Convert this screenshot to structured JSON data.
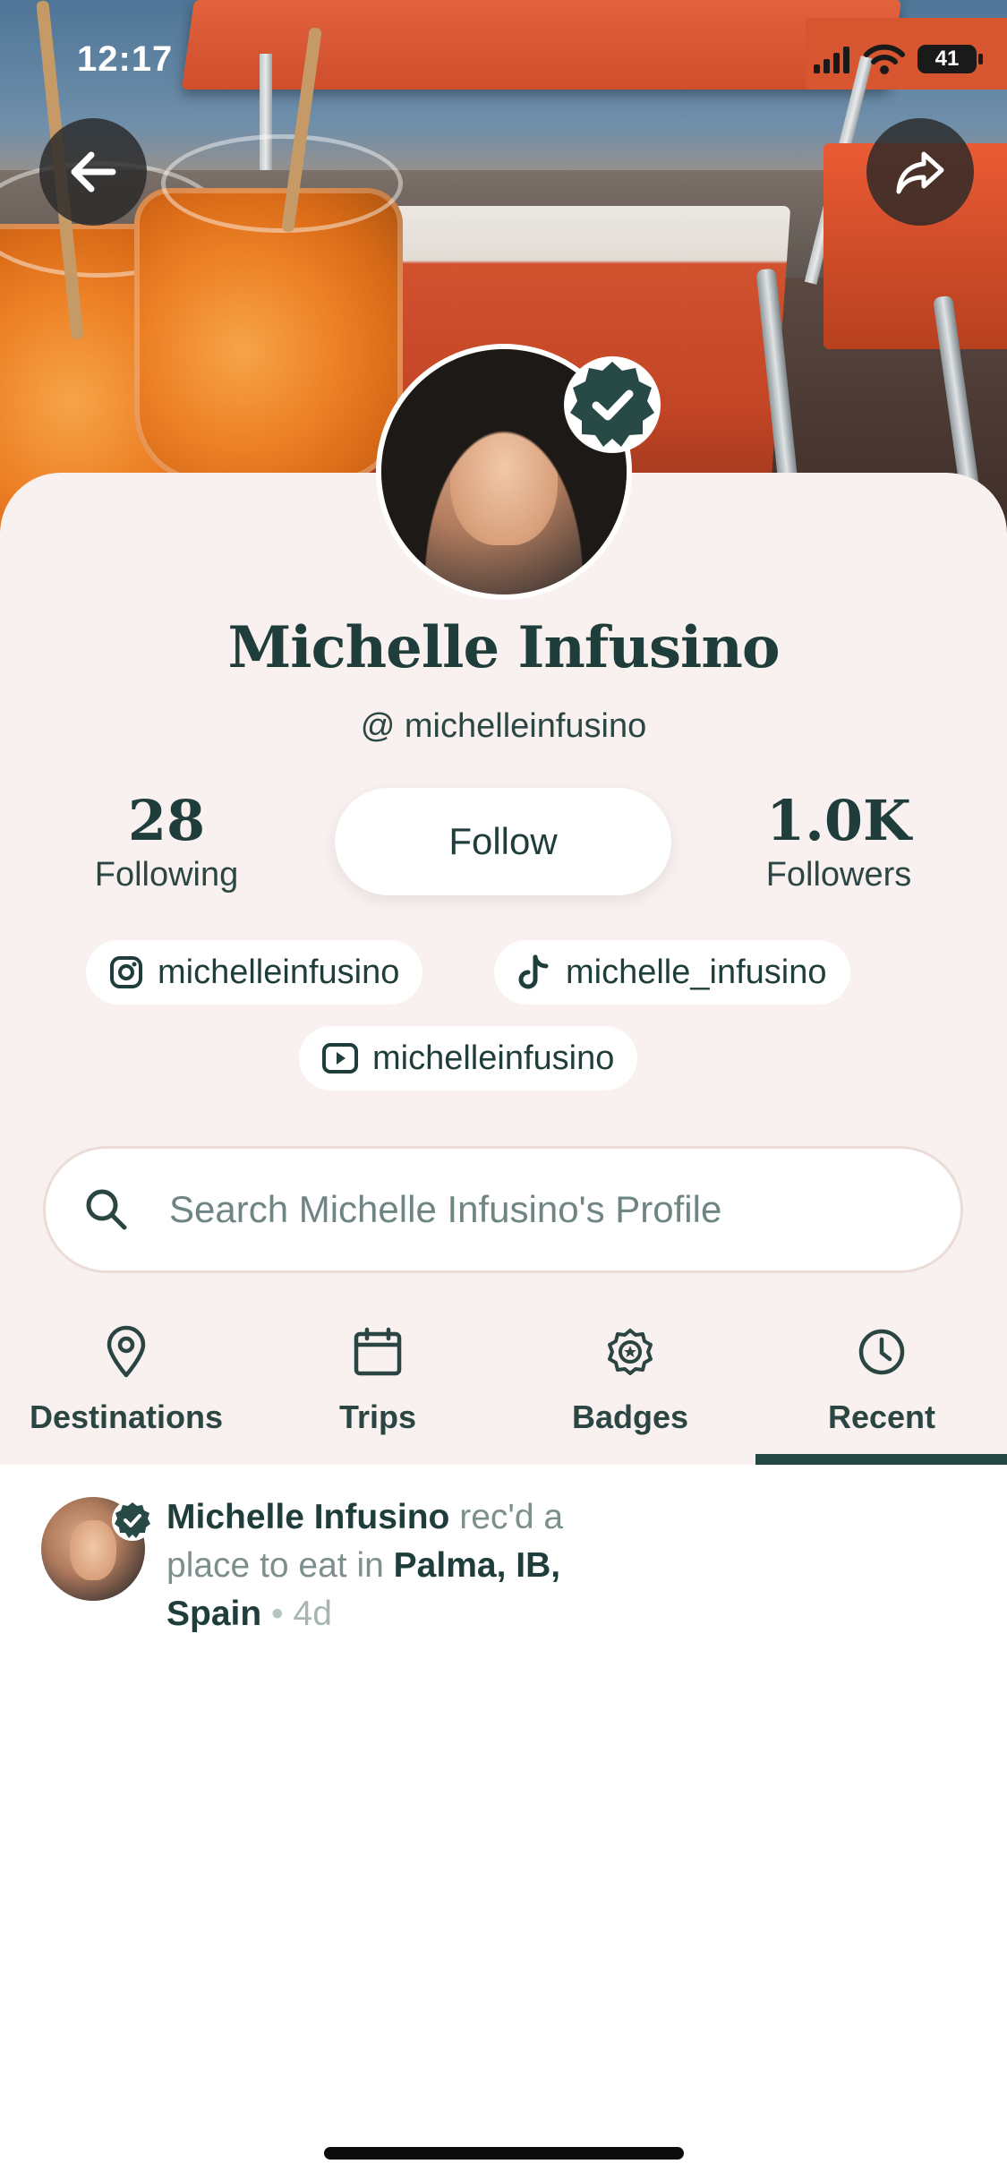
{
  "status_bar": {
    "time": "12:17",
    "battery": "41"
  },
  "profile": {
    "name": "Michelle Infusino",
    "handle": "@ michelleinfusino",
    "following_count": "28",
    "following_label": "Following",
    "followers_count": "1.0K",
    "followers_label": "Followers",
    "follow_label": "Follow"
  },
  "socials": [
    {
      "platform_icon": "instagram-icon",
      "label": "michelleinfusino"
    },
    {
      "platform_icon": "tiktok-icon",
      "label": "michelle_infusino"
    },
    {
      "platform_icon": "youtube-icon",
      "label": "michelleinfusino"
    }
  ],
  "search": {
    "placeholder": "Search Michelle Infusino's Profile"
  },
  "tabs": [
    {
      "label": "Destinations",
      "icon": "map-pin-icon"
    },
    {
      "label": "Trips",
      "icon": "calendar-icon"
    },
    {
      "label": "Badges",
      "icon": "badge-icon"
    },
    {
      "label": "Recent",
      "icon": "clock-icon",
      "active": true
    }
  ],
  "feed": [
    {
      "user": "Michelle Infusino",
      "action": " rec'd a place to eat in ",
      "place": "Palma, IB, Spain",
      "separator": " • ",
      "ago": "4d"
    }
  ],
  "colors": {
    "accent": "#244744",
    "sheet_bg": "#f9f1ef",
    "badge": "#284a47"
  }
}
